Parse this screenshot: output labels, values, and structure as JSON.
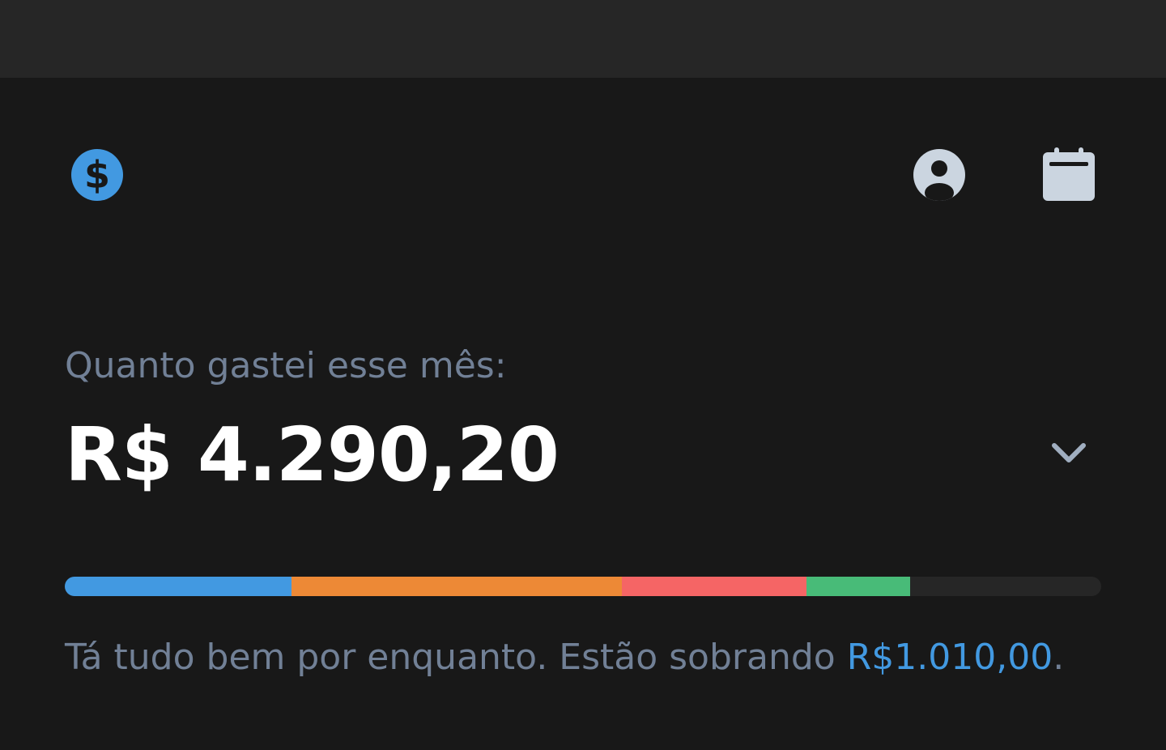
{
  "header": {
    "logo_icon": "dollar-circle-icon",
    "logo_glyph": "$",
    "profile_icon": "user-circle-icon",
    "calendar_icon": "calendar-icon"
  },
  "summary": {
    "label": "Quanto gastei esse mês:",
    "amount": "R$ 4.290,20",
    "expand_icon": "chevron-down-icon"
  },
  "budget_bar": {
    "segments": [
      {
        "color": "#4299e1",
        "fraction": 0.21875
      },
      {
        "color": "#ed8936",
        "fraction": 0.31875
      },
      {
        "color": "#f56565",
        "fraction": 0.178125
      },
      {
        "color": "#48bb78",
        "fraction": 0.1
      }
    ],
    "track_color": "#262626"
  },
  "status": {
    "prefix": "Tá tudo bem por enquanto. Estão sobrando ",
    "remaining": "R$1.010,00",
    "suffix": "."
  },
  "colors": {
    "accent": "#4299e1",
    "muted_text": "#718096",
    "icon_light": "#cbd5e0",
    "background": "#181818",
    "topbar": "#262626"
  }
}
